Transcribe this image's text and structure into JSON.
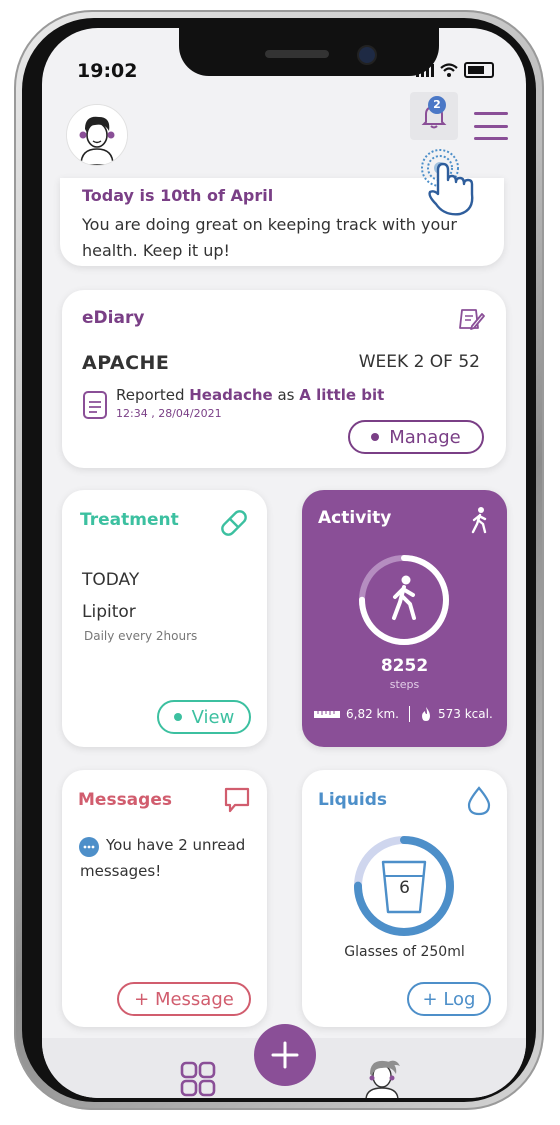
{
  "status_bar": {
    "time": "19:02"
  },
  "header": {
    "notification_count": "2"
  },
  "greeting": {
    "title": "Today is 10th of April",
    "message": "You are doing great on keeping track with your health. Keep it up!"
  },
  "ediary": {
    "title": "eDiary",
    "program": "APACHE",
    "week": "WEEK 2 OF 52",
    "report_prefix": "Reported ",
    "symptom": "Headache",
    "report_mid": " as ",
    "severity": "A little bit",
    "timestamp": "12:34 , 28/04/2021",
    "manage_label": "Manage"
  },
  "treatment": {
    "title": "Treatment",
    "day": "TODAY",
    "medication": "Lipitor",
    "frequency": "Daily every 2hours",
    "view_label": "View"
  },
  "activity": {
    "title": "Activity",
    "steps": "8252",
    "steps_label": "steps",
    "progress": 0.75,
    "distance": "6,82 km.",
    "calories": "573 kcal."
  },
  "messages": {
    "title": "Messages",
    "text": "You have 2 unread messages!",
    "button_label": "+ Message"
  },
  "liquids": {
    "title": "Liquids",
    "glasses": "6",
    "progress": 0.75,
    "label": "Glasses of 250ml",
    "button_label": "+ Log"
  },
  "colors": {
    "brand_purple": "#8a4f97",
    "treatment_green": "#3cc0a0",
    "messages_red": "#d15d6e",
    "liquids_blue": "#4d8fc9"
  },
  "icons": [
    "edit-icon",
    "document-icon",
    "pill-icon",
    "walk-icon",
    "ruler-icon",
    "flame-icon",
    "speech-bubble-icon",
    "chat-icon",
    "drop-icon",
    "glass-icon",
    "grid-icon",
    "plus-icon",
    "bell-icon",
    "menu-icon",
    "tap-hand-icon"
  ]
}
